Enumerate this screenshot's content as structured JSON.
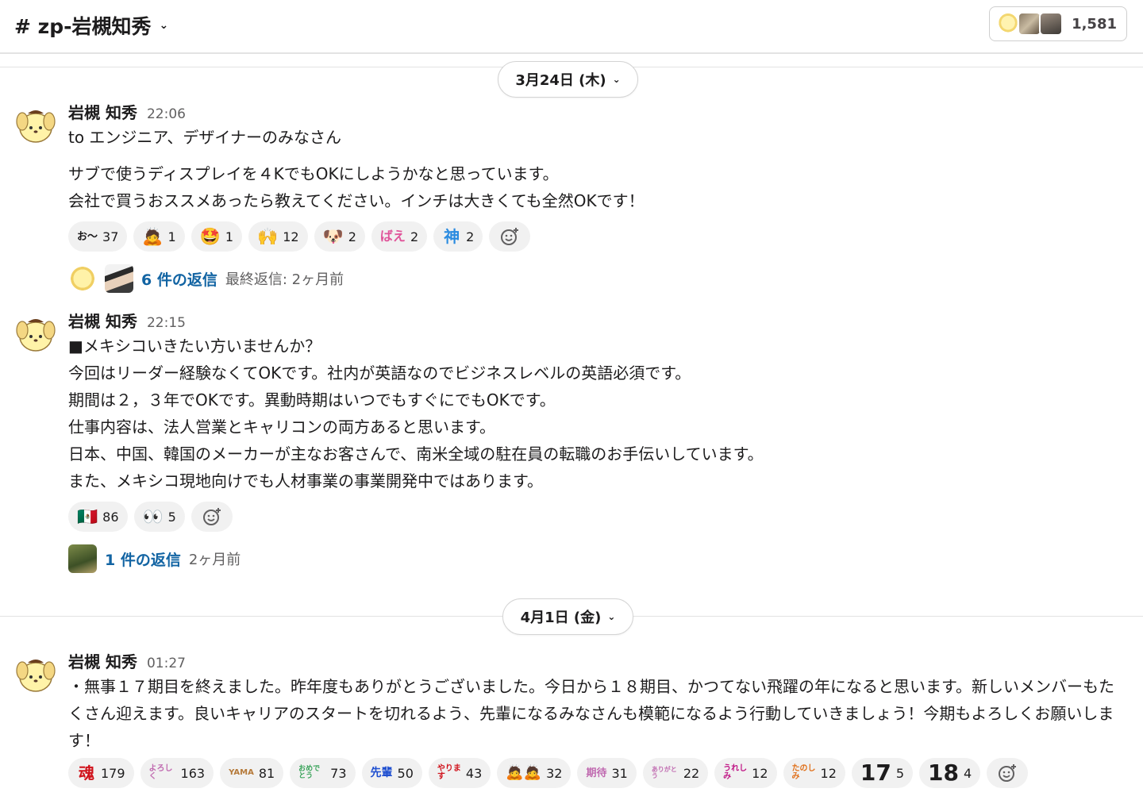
{
  "header": {
    "channel_name": "# zp-岩槻知秀",
    "member_count": "1,581"
  },
  "dates": {
    "d1": "3月24日 (木)",
    "d2": "4月1日 (金)"
  },
  "messages": [
    {
      "sender": "岩槻 知秀",
      "time": "22:06",
      "lines": [
        "to エンジニア、デザイナーのみなさん",
        "サブで使うディスプレイを４KでもOKにしようかなと思っています。",
        "会社で買うおススメあったら教えてください。インチは大きくても全然OKです！"
      ],
      "reactions": [
        {
          "icon": "お〜",
          "count": "37"
        },
        {
          "icon": "🙇",
          "count": "1"
        },
        {
          "icon": "🤩",
          "count": "1"
        },
        {
          "icon": "🙌",
          "count": "12"
        },
        {
          "icon": "🐶",
          "count": "2"
        },
        {
          "icon": "ばえ",
          "count": "2"
        },
        {
          "icon": "神",
          "count": "2"
        }
      ],
      "thread": {
        "link": "6 件の返信",
        "meta": "最終返信: 2ヶ月前"
      }
    },
    {
      "sender": "岩槻 知秀",
      "time": "22:15",
      "lines": [
        "■メキシコいきたい方いませんか？",
        "今回はリーダー経験なくてOKです。社内が英語なのでビジネスレベルの英語必須です。",
        "期間は２，３年でOKです。異動時期はいつでもすぐにでもOKです。",
        "仕事内容は、法人営業とキャリコンの両方あると思います。",
        "日本、中国、韓国のメーカーが主なお客さんで、南米全域の駐在員の転職のお手伝いしています。",
        "また、メキシコ現地向けでも人材事業の事業開発中ではあります。"
      ],
      "reactions": [
        {
          "icon": "🇲🇽",
          "count": "86"
        },
        {
          "icon": "👀",
          "count": "5"
        }
      ],
      "thread": {
        "link": "1 件の返信",
        "meta": "2ヶ月前"
      }
    },
    {
      "sender": "岩槻 知秀",
      "time": "01:27",
      "text": "・無事１７期目を終えました。昨年度もありがとうございました。今日から１８期目、かつてない飛躍の年になると思います。新しいメンバーもたくさん迎えます。良いキャリアのスタートを切れるよう、先輩になるみなさんも模範になるよう行動していきましょう！今期もよろしくお願いします！",
      "reactions": [
        {
          "icon": "魂",
          "count": "179"
        },
        {
          "icon": "よろしく",
          "count": "163"
        },
        {
          "icon": "YAMA",
          "count": "81"
        },
        {
          "icon": "おめでとう",
          "count": "73"
        },
        {
          "icon": "先輩",
          "count": "50"
        },
        {
          "icon": "やります",
          "count": "43"
        },
        {
          "icon": "🙇🙇",
          "count": "32"
        },
        {
          "icon": "期待",
          "count": "31"
        },
        {
          "icon": "ありがとう",
          "count": "22"
        },
        {
          "icon": "うれしみ",
          "count": "12"
        },
        {
          "icon": "たのしみ",
          "count": "12"
        },
        {
          "icon": "17",
          "count": "5"
        },
        {
          "icon": "18",
          "count": "4"
        }
      ]
    }
  ],
  "icons": {
    "chevron": "chevron-down-icon",
    "add_reaction": "add-reaction-icon"
  }
}
